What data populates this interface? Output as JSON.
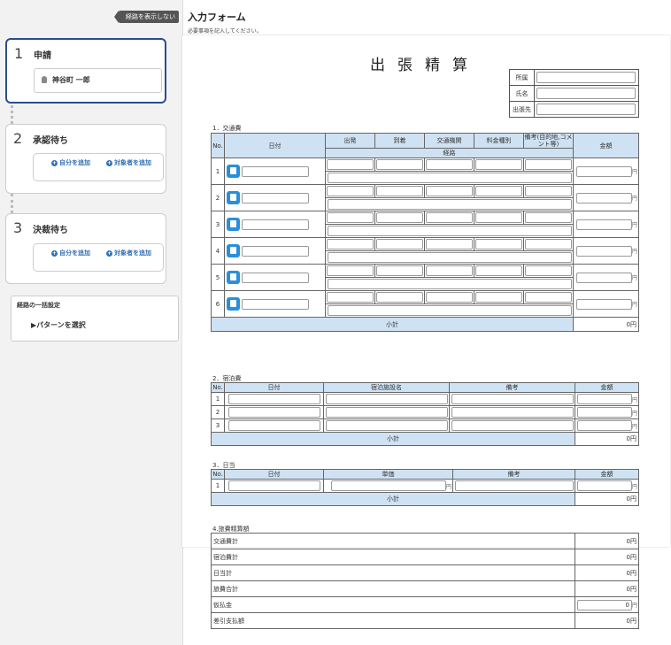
{
  "sidebar": {
    "hide_route": "経路を表示しない",
    "steps": [
      {
        "num": "1",
        "title": "申請",
        "applicant": "神谷町 一郎"
      },
      {
        "num": "2",
        "title": "承認待ち",
        "add_self": "自分を追加",
        "add_target": "対象者を追加"
      },
      {
        "num": "3",
        "title": "決裁待ち",
        "add_self": "自分を追加",
        "add_target": "対象者を追加"
      }
    ],
    "bulk": {
      "title": "経路の一括設定",
      "select": "▶パターンを選択"
    }
  },
  "form": {
    "title": "入力フォーム",
    "subtitle": "必要事項を記入してください。",
    "doc_title": "出張精算",
    "info_labels": [
      "所属",
      "氏名",
      "出張先"
    ],
    "transport": {
      "section": "1．交通費",
      "headers": {
        "no": "No.",
        "date": "日付",
        "dep": "出発",
        "arr": "到着",
        "means": "交通機関",
        "fare": "料金種別",
        "note": "備考(目的地,コメント等)",
        "route": "経路",
        "amount": "金額"
      },
      "rows": [
        "1",
        "2",
        "3",
        "4",
        "5",
        "6"
      ],
      "subtotal": "小計",
      "subtotal_value": "0円"
    },
    "lodging": {
      "section": "2．宿泊費",
      "headers": {
        "no": "No.",
        "date": "日付",
        "name": "宿泊施設名",
        "note": "備考",
        "amount": "金額"
      },
      "rows": [
        "1",
        "2",
        "3"
      ],
      "subtotal": "小計",
      "subtotal_value": "0円"
    },
    "daily": {
      "section": "3．日当",
      "headers": {
        "no": "No.",
        "date": "日付",
        "unit": "単価",
        "note": "備考",
        "amount": "金額"
      },
      "rows": [
        "1"
      ],
      "subtotal": "小計",
      "subtotal_value": "0円"
    },
    "summary": {
      "section": "4.旅費精算額",
      "rows": [
        {
          "label": "交通費計",
          "value": "0円"
        },
        {
          "label": "宿泊費計",
          "value": "0円"
        },
        {
          "label": "日当計",
          "value": "0円"
        },
        {
          "label": "旅費合計",
          "value": "0円"
        },
        {
          "label": "仮払金",
          "value": "0"
        },
        {
          "label": "差引支払額",
          "value": "0円"
        }
      ]
    },
    "yen": "円"
  }
}
